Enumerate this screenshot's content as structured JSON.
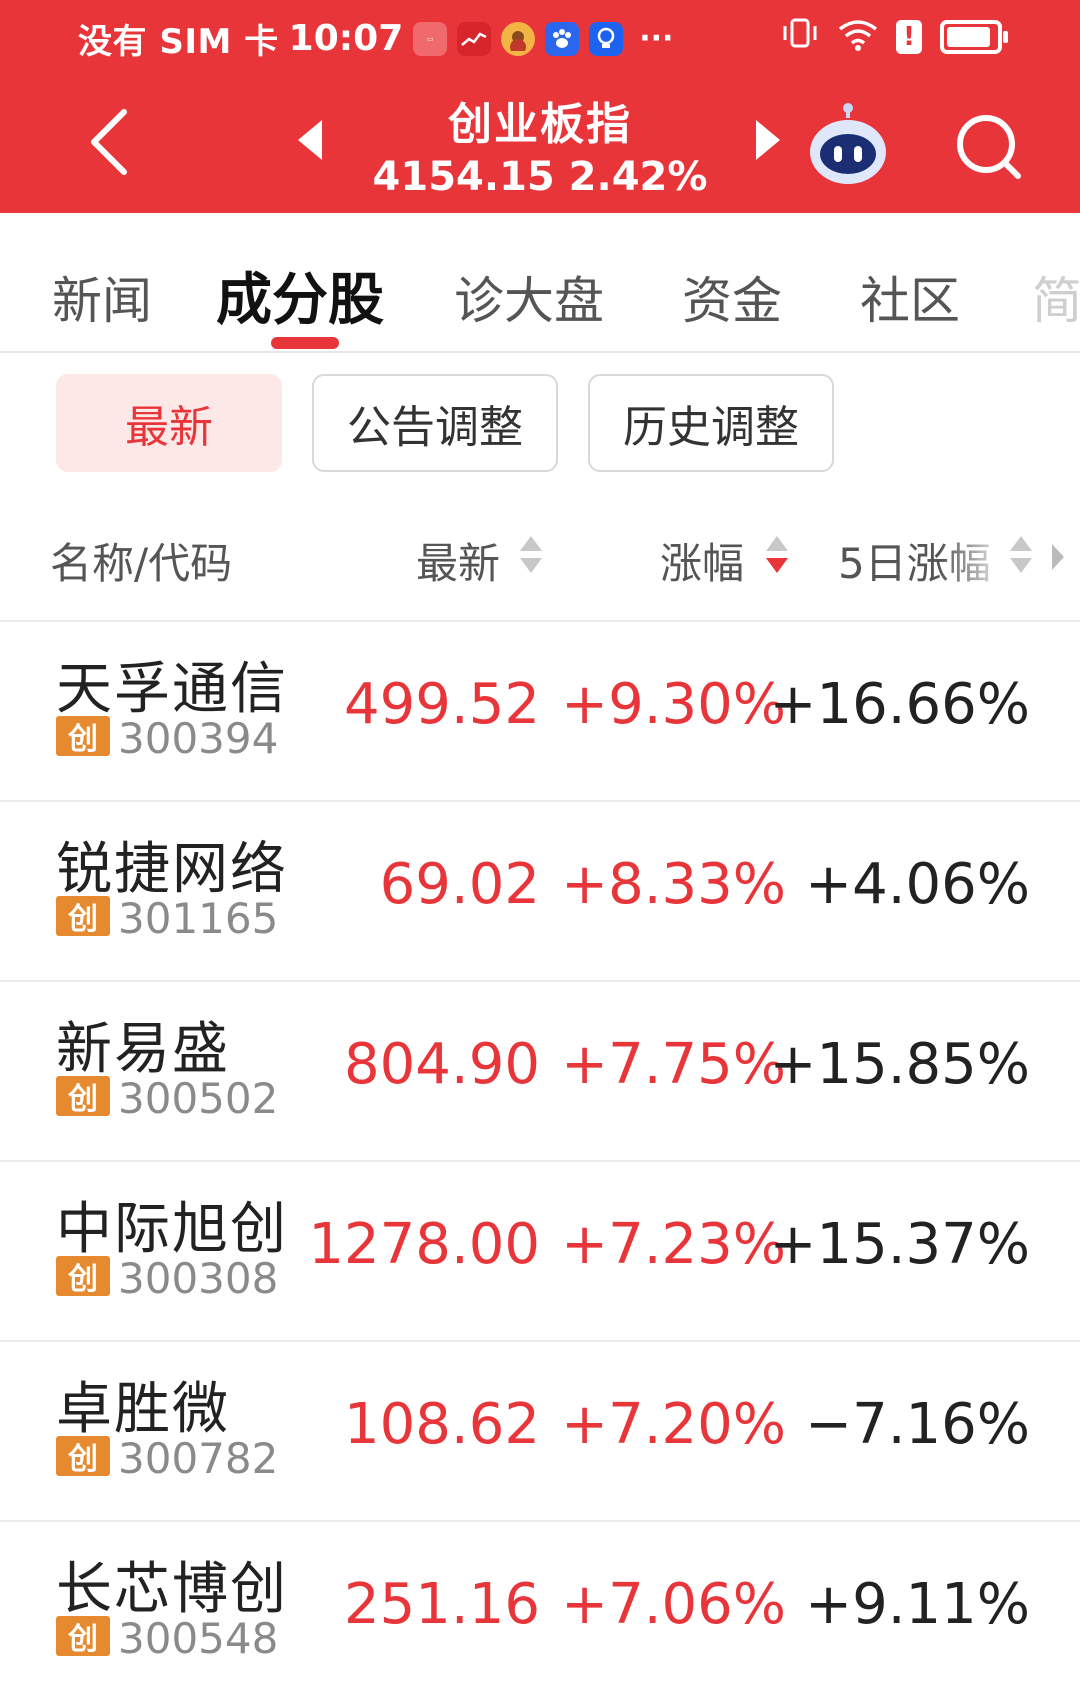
{
  "status_bar": {
    "carrier": "没有 SIM 卡",
    "time": "10:07",
    "dots": "···",
    "alert": "!"
  },
  "header": {
    "index_name": "创业板指",
    "index_value": "4154.15 2.42%"
  },
  "tabs": [
    {
      "label": "新闻"
    },
    {
      "label": "成分股"
    },
    {
      "label": "诊大盘"
    },
    {
      "label": "资金"
    },
    {
      "label": "社区"
    },
    {
      "label": "简"
    }
  ],
  "filters": [
    {
      "label": "最新"
    },
    {
      "label": "公告调整"
    },
    {
      "label": "历史调整"
    }
  ],
  "columns": {
    "name": "名称/代码",
    "latest": "最新",
    "change": "涨幅",
    "change_5d": "5日涨幅"
  },
  "stocks": [
    {
      "name": "天孚通信",
      "badge": "创",
      "code": "300394",
      "latest": "499.52",
      "change": "+9.30%",
      "change_5d": "+16.66%"
    },
    {
      "name": "锐捷网络",
      "badge": "创",
      "code": "301165",
      "latest": "69.02",
      "change": "+8.33%",
      "change_5d": "+4.06%"
    },
    {
      "name": "新易盛",
      "badge": "创",
      "code": "300502",
      "latest": "804.90",
      "change": "+7.75%",
      "change_5d": "+15.85%"
    },
    {
      "name": "中际旭创",
      "badge": "创",
      "code": "300308",
      "latest": "1278.00",
      "change": "+7.23%",
      "change_5d": "+15.37%"
    },
    {
      "name": "卓胜微",
      "badge": "创",
      "code": "300782",
      "latest": "108.62",
      "change": "+7.20%",
      "change_5d": "−7.16%"
    },
    {
      "name": "长芯博创",
      "badge": "创",
      "code": "300548",
      "latest": "251.16",
      "change": "+7.06%",
      "change_5d": "+9.11%"
    }
  ],
  "colors": {
    "brand_red": "#e8353a",
    "badge_orange": "#e58a2e",
    "active_filter_bg": "#fde8e8"
  }
}
